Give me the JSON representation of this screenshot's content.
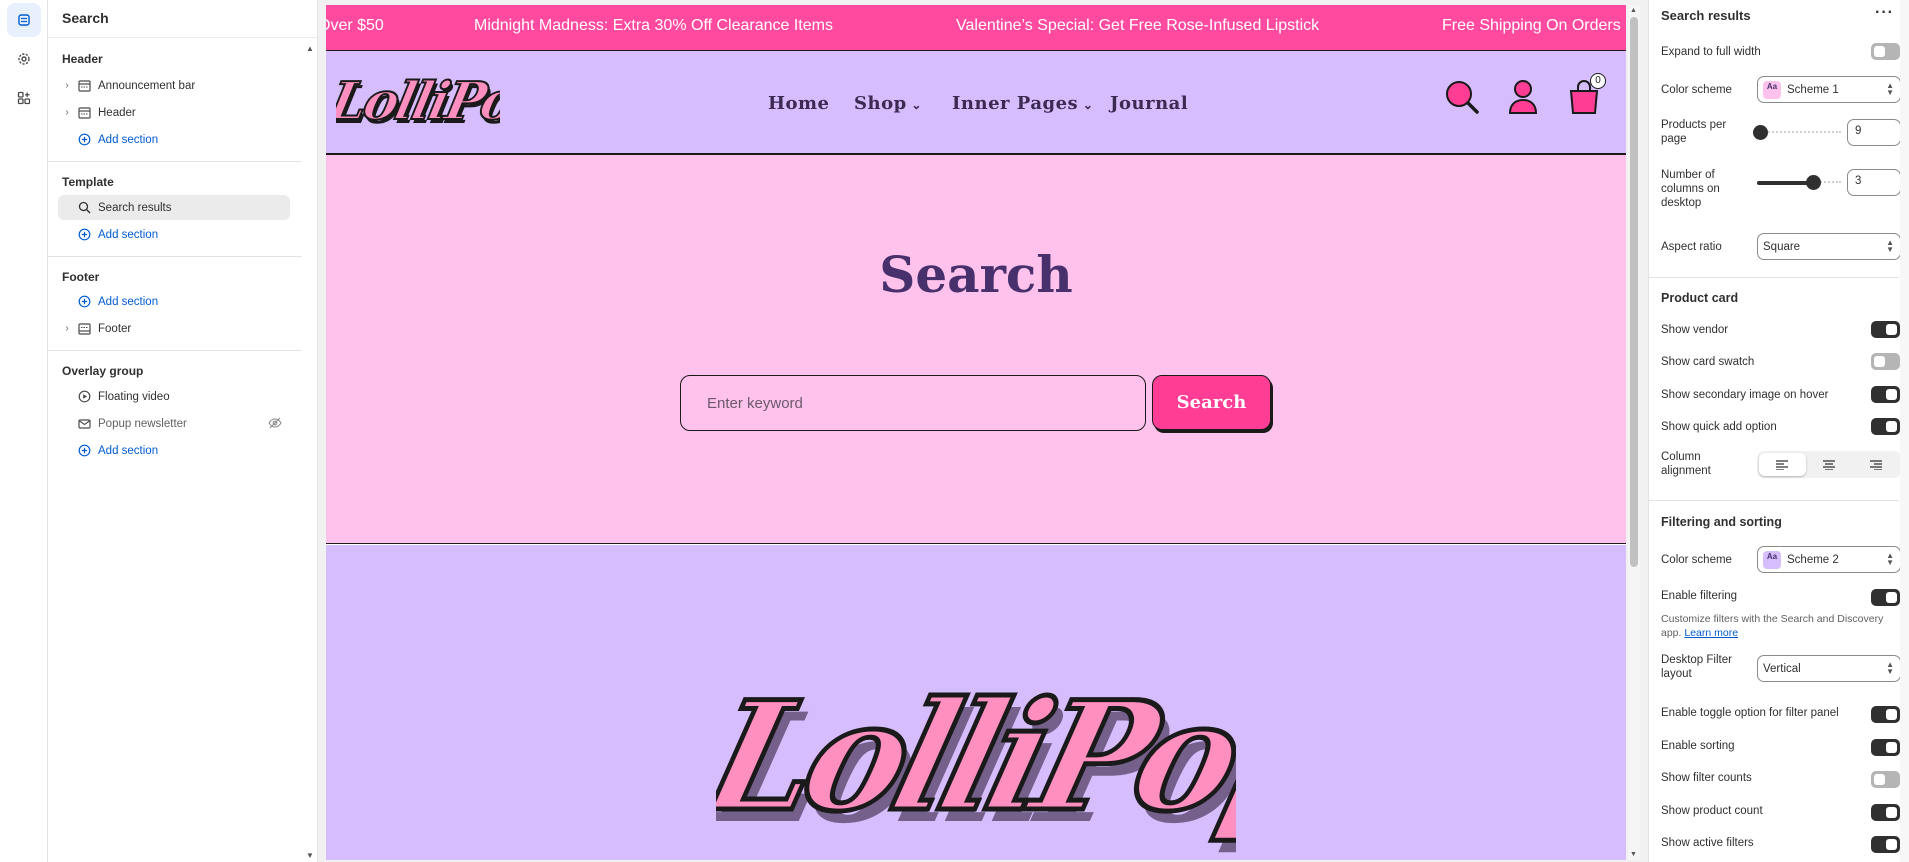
{
  "rail": {
    "items": [
      "sections-icon",
      "settings-icon",
      "apps-icon"
    ]
  },
  "left": {
    "title": "Search",
    "groups": {
      "header": {
        "title": "Header",
        "items": [
          "Announcement bar",
          "Header"
        ],
        "add": "Add section"
      },
      "template": {
        "title": "Template",
        "items": [
          "Search results"
        ],
        "add": "Add section"
      },
      "footer": {
        "title": "Footer",
        "add": "Add section",
        "items": [
          "Footer"
        ]
      },
      "overlay": {
        "title": "Overlay group",
        "items": [
          "Floating video",
          "Popup newsletter"
        ],
        "add": "Add section"
      }
    }
  },
  "preview": {
    "announcements": [
      "Over $50",
      "Midnight Madness: Extra 30% Off Clearance Items",
      "Valentine’s Special: Get Free Rose-Infused Lipstick",
      "Free Shipping On Orders"
    ],
    "logo": "LolliPop",
    "nav": [
      "Home",
      "Shop",
      "Inner Pages",
      "Journal"
    ],
    "cart_count": "0",
    "hero_title": "Search",
    "search_placeholder": "Enter keyword",
    "search_button": "Search",
    "footer_logo": "LolliPop"
  },
  "right": {
    "title": "Search results",
    "expand_label": "Expand to full width",
    "color_scheme_label": "Color scheme",
    "color_scheme_value": "Scheme 1",
    "products_per_page_label": "Products per page",
    "products_per_page_value": "9",
    "products_per_page_fraction": 0.04,
    "columns_label": "Number of columns on desktop",
    "columns_value": "3",
    "columns_fraction": 0.67,
    "aspect_label": "Aspect ratio",
    "aspect_value": "Square",
    "product_card_title": "Product card",
    "show_vendor": "Show vendor",
    "show_swatch": "Show card swatch",
    "show_secondary": "Show secondary image on hover",
    "show_quick_add": "Show quick add option",
    "column_alignment": "Column alignment",
    "filtering_title": "Filtering and sorting",
    "color_scheme2_label": "Color scheme",
    "color_scheme2_value": "Scheme 2",
    "enable_filtering": "Enable filtering",
    "help_text": "Customize filters with the Search and Discovery app.",
    "learn_more": "Learn more",
    "desktop_filter_label": "Desktop Filter layout",
    "desktop_filter_value": "Vertical",
    "toggle_filter_panel": "Enable toggle option for filter panel",
    "enable_sorting": "Enable sorting",
    "show_filter_counts": "Show filter counts",
    "show_product_count": "Show product count",
    "show_active_filters": "Show active filters"
  },
  "colors": {
    "pink": "#ff4aa0",
    "lavender": "#d6bdfd",
    "light_pink": "#ffc2ec",
    "purple_text": "#47306b"
  }
}
